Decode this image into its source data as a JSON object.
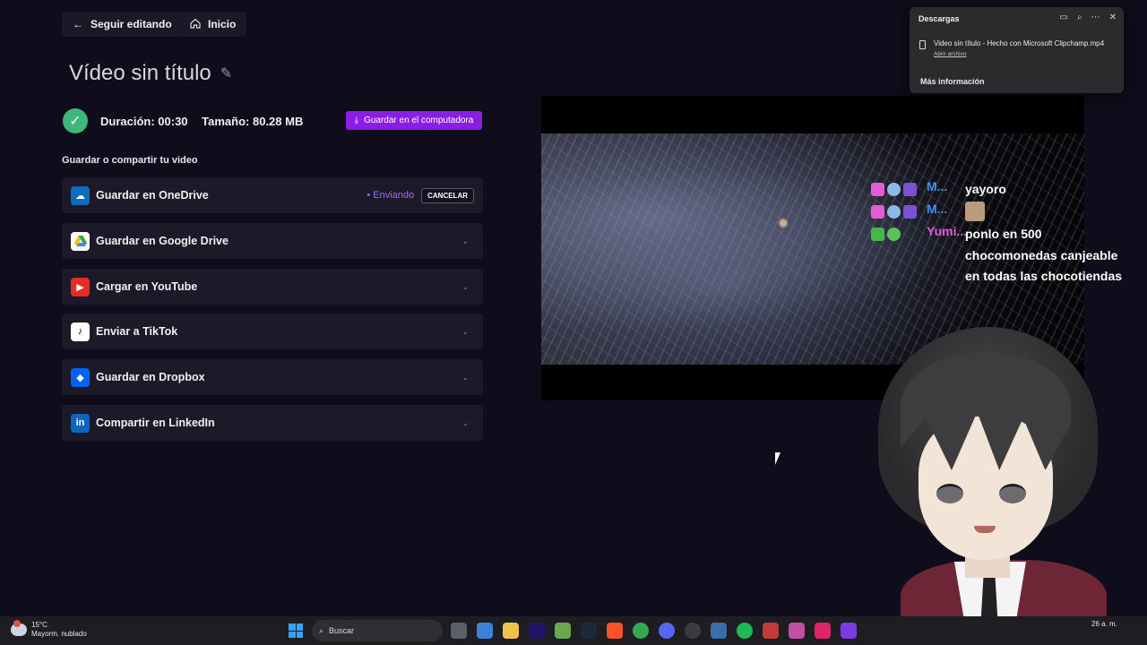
{
  "nav": {
    "back_label": "Seguir editando",
    "home_label": "Inicio"
  },
  "video": {
    "title": "Vídeo sin título",
    "duration_label": "Duración: 00:30",
    "size_label": "Tamaño: 80.28 MB",
    "save_computer_label": "Guardar en el computadora"
  },
  "share": {
    "section_label": "Guardar o compartir tu video",
    "options": [
      {
        "label": "Guardar en OneDrive",
        "icon": "onedrive-icon",
        "color": "#0f6cbd",
        "status": "Enviando",
        "cancel_label": "CANCELAR"
      },
      {
        "label": "Guardar en Google Drive",
        "icon": "google-drive-icon",
        "color": "#ffffff"
      },
      {
        "label": "Cargar en YouTube",
        "icon": "youtube-icon",
        "color": "#e52d27"
      },
      {
        "label": "Enviar a TikTok",
        "icon": "tiktok-icon",
        "color": "#ffffff"
      },
      {
        "label": "Guardar en Dropbox",
        "icon": "dropbox-icon",
        "color": "#0061fe"
      },
      {
        "label": "Compartir en LinkedIn",
        "icon": "linkedin-icon",
        "color": "#0a66c2"
      }
    ]
  },
  "chat": [
    {
      "user": "M...",
      "user_color": "#4a8cf0",
      "message": "yayoro"
    },
    {
      "user": "M...",
      "user_color": "#4a8cf0",
      "message": ""
    },
    {
      "user": "Yumi...",
      "user_color": "#e45ad8",
      "message": "ponlo en 500 chocomonedas canjeable en todas las chocotiendas"
    }
  ],
  "downloads": {
    "title": "Descargas",
    "file_name": "Video sin título - Hecho con Microsoft Clipchamp.mp4",
    "open_label": "Abrir archivo",
    "more_info_label": "Más información"
  },
  "taskbar": {
    "temperature": "15°C",
    "weather": "Mayorm. nublado",
    "search_placeholder": "Buscar",
    "clock": "26 a. m."
  },
  "colors": {
    "accent": "#8a1ee6",
    "success": "#3fb67a",
    "sending": "#9b6ef5"
  }
}
